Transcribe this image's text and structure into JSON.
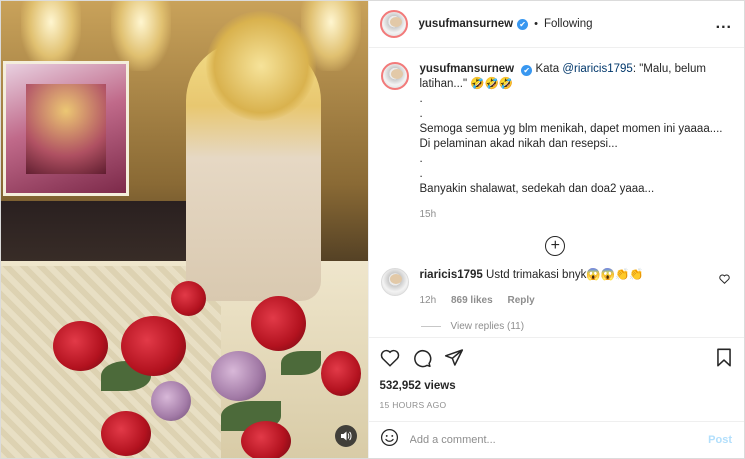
{
  "post": {
    "username": "yusufmansurnew",
    "separator": "•",
    "follow_state": "Following",
    "more": "..."
  },
  "caption": {
    "username": "yusufmansurnew",
    "prefix": "Kata ",
    "mention": "@riaricis1795",
    "text_after_mention": ": \"Malu, belum latihan...\" 🤣🤣🤣",
    "lines": ".\n.\nSemoga semua yg blm menikah, dapet momen ini yaaaa.... Di pelaminan akad nikah dan resepsi...\n.\n.\nBanyakin shalawat, sedekah dan doa2 yaaa...",
    "time": "15h"
  },
  "reply": {
    "username": "riaricis1795",
    "text": "Ustd trimakasi bnyk😱😱👏👏",
    "time": "12h",
    "likes": "869 likes",
    "reply_label": "Reply",
    "view_replies": "View replies (11)"
  },
  "stats": {
    "views": "532,952 views",
    "posted": "15 HOURS AGO"
  },
  "comment_box": {
    "placeholder": "Add a comment...",
    "post_label": "Post"
  },
  "icons": {
    "verified": "✔",
    "heart": "heart-icon",
    "comment": "comment-icon",
    "share": "share-icon",
    "save": "bookmark-icon",
    "emoji": "emoji-icon",
    "sound": "speaker-icon",
    "load_more": "plus-circle-icon"
  },
  "colors": {
    "link": "#00376b",
    "verified": "#3897f0",
    "muted": "#8e8e8e",
    "post_disabled": "#b2dffc"
  }
}
